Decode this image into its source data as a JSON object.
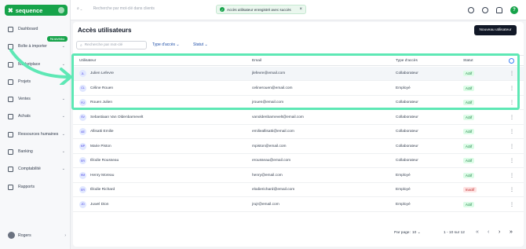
{
  "app": {
    "logo": "sequence",
    "logo_mark": "✖"
  },
  "sidebar": {
    "items": [
      {
        "label": "Dashboard",
        "has_chevron": false,
        "top": 0
      },
      {
        "label": "Boîte à importer",
        "has_chevron": true
      },
      {
        "label": "Marketplace",
        "has_chevron": true
      },
      {
        "label": "Projets",
        "has_chevron": false
      },
      {
        "label": "Ventes",
        "has_chevron": true
      },
      {
        "label": "Achats",
        "has_chevron": true
      },
      {
        "label": "Ressources humaines",
        "has_chevron": true
      },
      {
        "label": "Banking",
        "has_chevron": true
      },
      {
        "label": "Comptabilité",
        "has_chevron": true
      },
      {
        "label": "Rapports",
        "has_chevron": false
      }
    ],
    "new_badge": "Nouveau",
    "user": {
      "name": "Rogers",
      "chevron": "›"
    }
  },
  "topbar": {
    "search_placeholder": "Recherche par mot-clé dans clients",
    "toast": "Accès utilisateur enregistré avec succès",
    "help": "?"
  },
  "page": {
    "title": "Accès utilisateurs",
    "new_button": "Nouveau utilisateur",
    "search_placeholder": "Recherche par mot-clé",
    "filters": [
      "Type d'accès",
      "Statut"
    ],
    "columns": [
      "Utilisateur",
      "Email",
      "Type d'accès",
      "Statut"
    ]
  },
  "rows": [
    {
      "initials": "JL",
      "name": "Julien Lefevre",
      "email": "jlefevre@email.com",
      "type": "Collaborateur",
      "status": "Actif"
    },
    {
      "initials": "CL",
      "name": "Céline Rouen",
      "email": "celinerouen@email.com",
      "type": "Employé",
      "status": "Actif"
    },
    {
      "initials": "RJ",
      "name": "Rouen Julien",
      "email": "jrouen@email.com",
      "type": "Collaborateur",
      "status": "Actif"
    },
    {
      "initials": "SV",
      "name": "Sebastiaan Van Oldenbarnevelt",
      "email": "vanoldenbarnevelt@email.com",
      "type": "Collaborateur",
      "status": "Actif"
    },
    {
      "initials": "AE",
      "name": "Allisatti Emilie",
      "email": "emilieallisatti@email.com",
      "type": "Collaborateur",
      "status": "Actif"
    },
    {
      "initials": "MP",
      "name": "Marie Piston",
      "email": "mpiston@email.com",
      "type": "Collaborateur",
      "status": "Actif"
    },
    {
      "initials": "ER",
      "name": "Élodie Rousseau",
      "email": "erousseau@email.com",
      "type": "Collaborateur",
      "status": "Actif"
    },
    {
      "initials": "HM",
      "name": "Henry Moreau",
      "email": "henry@email.com",
      "type": "Employé",
      "status": "Actif"
    },
    {
      "initials": "ER",
      "name": "Élodie Richard",
      "email": "elodierichard@email.com",
      "type": "Employé",
      "status": "Inactif"
    },
    {
      "initials": "JD",
      "name": "Juwel Dion",
      "email": "jrujr@email.com",
      "type": "Employé",
      "status": "Actif"
    }
  ],
  "pagination": {
    "per_page_label": "Par page:",
    "per_page": "10",
    "range": "1 - 10 sur 12"
  },
  "colors": {
    "accent": "#16a34a",
    "highlight": "#5ee8b5",
    "link": "#1f4fa8"
  }
}
